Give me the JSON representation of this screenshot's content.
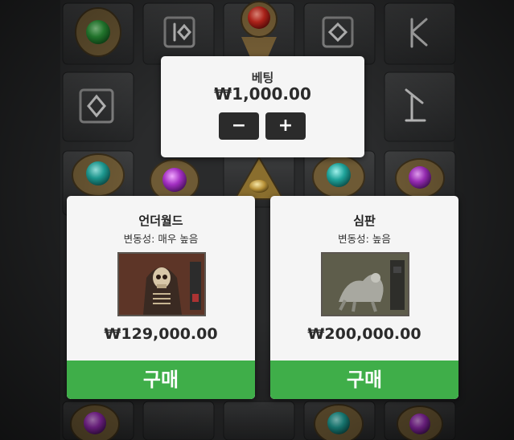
{
  "colors": {
    "buy_button": "#3fae49",
    "card_bg": "#f5f5f5",
    "step_button": "#2b2b2b",
    "board_bg": "#1d1e1f"
  },
  "background": {
    "gems": [
      "green-gem",
      "red-gem",
      "teal-gem",
      "purple-gem",
      "teal-gem",
      "gold-eye"
    ],
    "runes": [
      "rune-tile",
      "rune-tile",
      "rune-tile",
      "rune-tile",
      "rune-tile"
    ]
  },
  "bet": {
    "label": "베팅",
    "amount": "₩1,000.00",
    "minus_label": "−",
    "plus_label": "+"
  },
  "features": [
    {
      "name": "언더월드",
      "volatility": "변동성: 매우 높음",
      "image": "skeleton-reaper-art",
      "price": "₩129,000.00",
      "buy_label": "구매"
    },
    {
      "name": "심판",
      "volatility": "변동성: 높음",
      "image": "beast-creature-art",
      "price": "₩200,000.00",
      "buy_label": "구매"
    }
  ]
}
